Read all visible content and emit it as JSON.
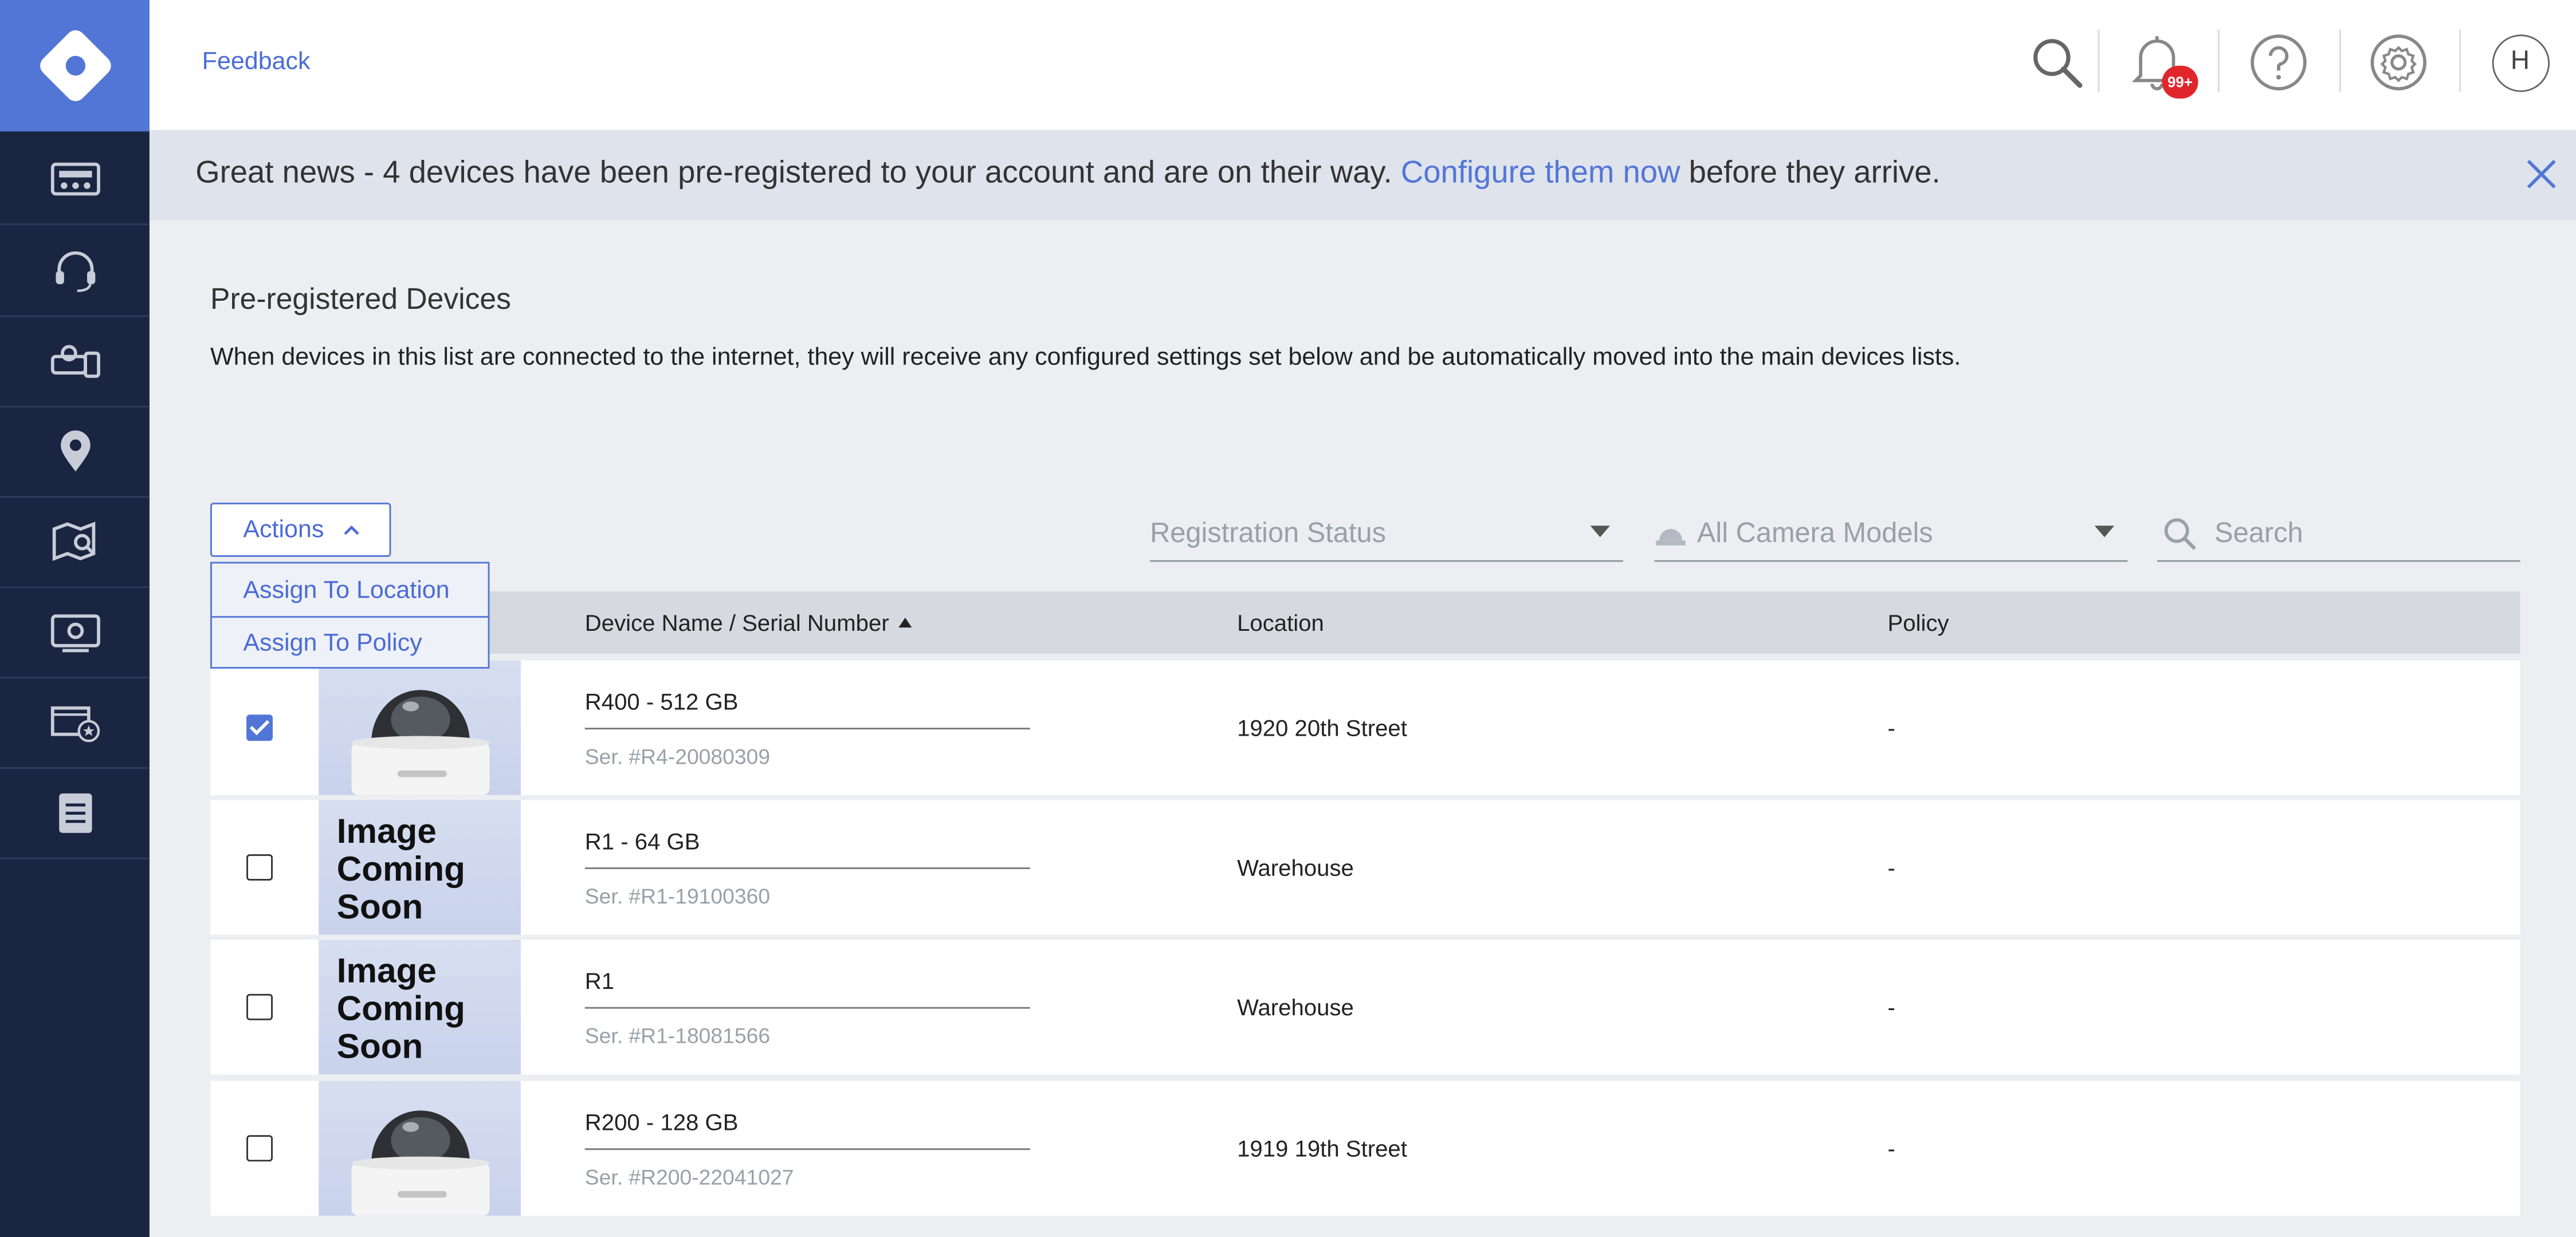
{
  "topbar": {
    "feedback_label": "Feedback",
    "notification_badge": "99+",
    "avatar_initial": "H"
  },
  "banner": {
    "text_before": "Great news - 4 devices have been pre-registered to your account and are on their way. ",
    "link_text": "Configure them now",
    "text_after": " before they arrive."
  },
  "sidebar": {
    "items": [
      {
        "icon": "dashboard-icon"
      },
      {
        "icon": "headset-icon"
      },
      {
        "icon": "devices-icon"
      },
      {
        "icon": "location-pin-icon"
      },
      {
        "icon": "map-search-icon"
      },
      {
        "icon": "monitor-icon"
      },
      {
        "icon": "video-star-icon"
      },
      {
        "icon": "reports-icon"
      }
    ]
  },
  "page": {
    "title": "Pre-registered Devices",
    "description": "When devices in this list are connected to the internet, they will receive any configured settings set below and be automatically moved into the main devices lists."
  },
  "actions": {
    "label": "Actions",
    "menu": [
      "Assign To Location",
      "Assign To Policy"
    ]
  },
  "filters": {
    "registration_status": "Registration Status",
    "camera_models": "All Camera Models",
    "search_placeholder": "Search"
  },
  "table": {
    "columns": [
      "Device Name / Serial Number",
      "Location",
      "Policy"
    ],
    "rows": [
      {
        "checked": true,
        "image": "camera",
        "name": "R400  -  512 GB",
        "serial": "Ser. #R4-20080309",
        "location": "1920 20th Street",
        "policy": "-"
      },
      {
        "checked": false,
        "image": "placeholder",
        "image_text": "Image Coming Soon",
        "name": "R1  -  64 GB",
        "serial": "Ser. #R1-19100360",
        "location": "Warehouse",
        "policy": "-"
      },
      {
        "checked": false,
        "image": "placeholder",
        "image_text": "Image Coming Soon",
        "name": "R1",
        "serial": "Ser. #R1-18081566",
        "location": "Warehouse",
        "policy": "-"
      },
      {
        "checked": false,
        "image": "camera",
        "name": "R200  -  128 GB",
        "serial": "Ser. #R200-22041027",
        "location": "1919 19th Street",
        "policy": "-"
      }
    ]
  },
  "colors": {
    "sidebar_bg": "#1a2541",
    "accent": "#5276d6",
    "banner_bg": "#dfe3eb",
    "badge": "#e0262b"
  }
}
